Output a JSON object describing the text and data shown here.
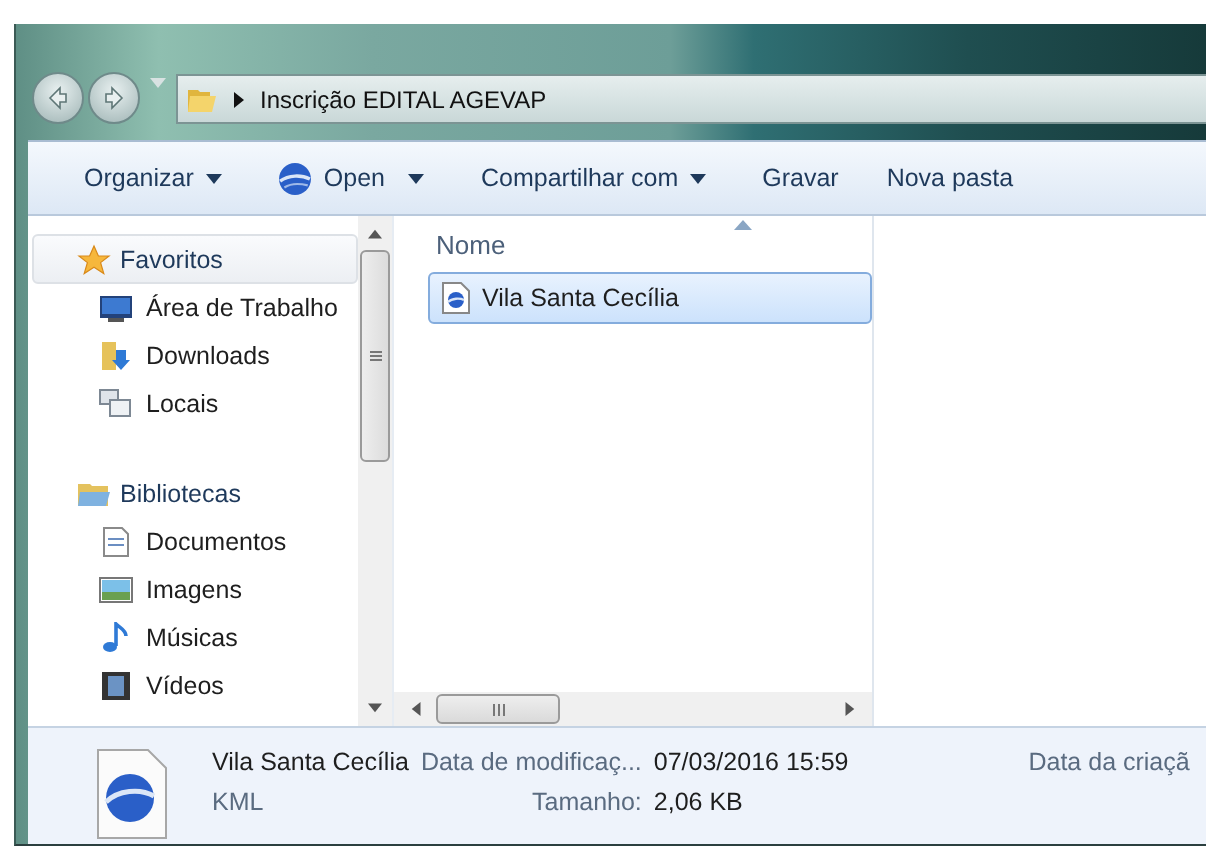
{
  "address": {
    "crumbs": [
      "Inscrição EDITAL AGEVAP"
    ]
  },
  "toolbar": [
    {
      "label": "Organizar",
      "kind": "menu"
    },
    {
      "label": "Open",
      "kind": "app-menu"
    },
    {
      "label": "Compartilhar com",
      "kind": "menu"
    },
    {
      "label": "Gravar",
      "kind": "plain"
    },
    {
      "label": "Nova pasta",
      "kind": "plain"
    }
  ],
  "sidebar": {
    "groups": [
      {
        "label": "Favoritos",
        "kind": "star",
        "selected": true,
        "children": [
          {
            "label": "Área de Trabalho",
            "kind": "desktop"
          },
          {
            "label": "Downloads",
            "kind": "downloads"
          },
          {
            "label": "Locais",
            "kind": "places"
          }
        ]
      },
      {
        "label": "Bibliotecas",
        "kind": "library",
        "selected": false,
        "children": [
          {
            "label": "Documentos",
            "kind": "document"
          },
          {
            "label": "Imagens",
            "kind": "image"
          },
          {
            "label": "Músicas",
            "kind": "music"
          },
          {
            "label": "Vídeos",
            "kind": "video"
          }
        ]
      }
    ]
  },
  "file_list": {
    "columns": [
      {
        "label": "Nome",
        "sorted": true
      }
    ],
    "rows": [
      {
        "name": "Vila Santa Cecília",
        "selected": true
      }
    ]
  },
  "details": {
    "name": "Vila Santa Cecília",
    "type": "KML",
    "fields": [
      {
        "label": "Data de modificaç...",
        "value": "07/03/2016 15:59"
      },
      {
        "label": "Tamanho:",
        "value": "2,06 KB"
      }
    ],
    "extra_label": "Data da criaçã"
  }
}
